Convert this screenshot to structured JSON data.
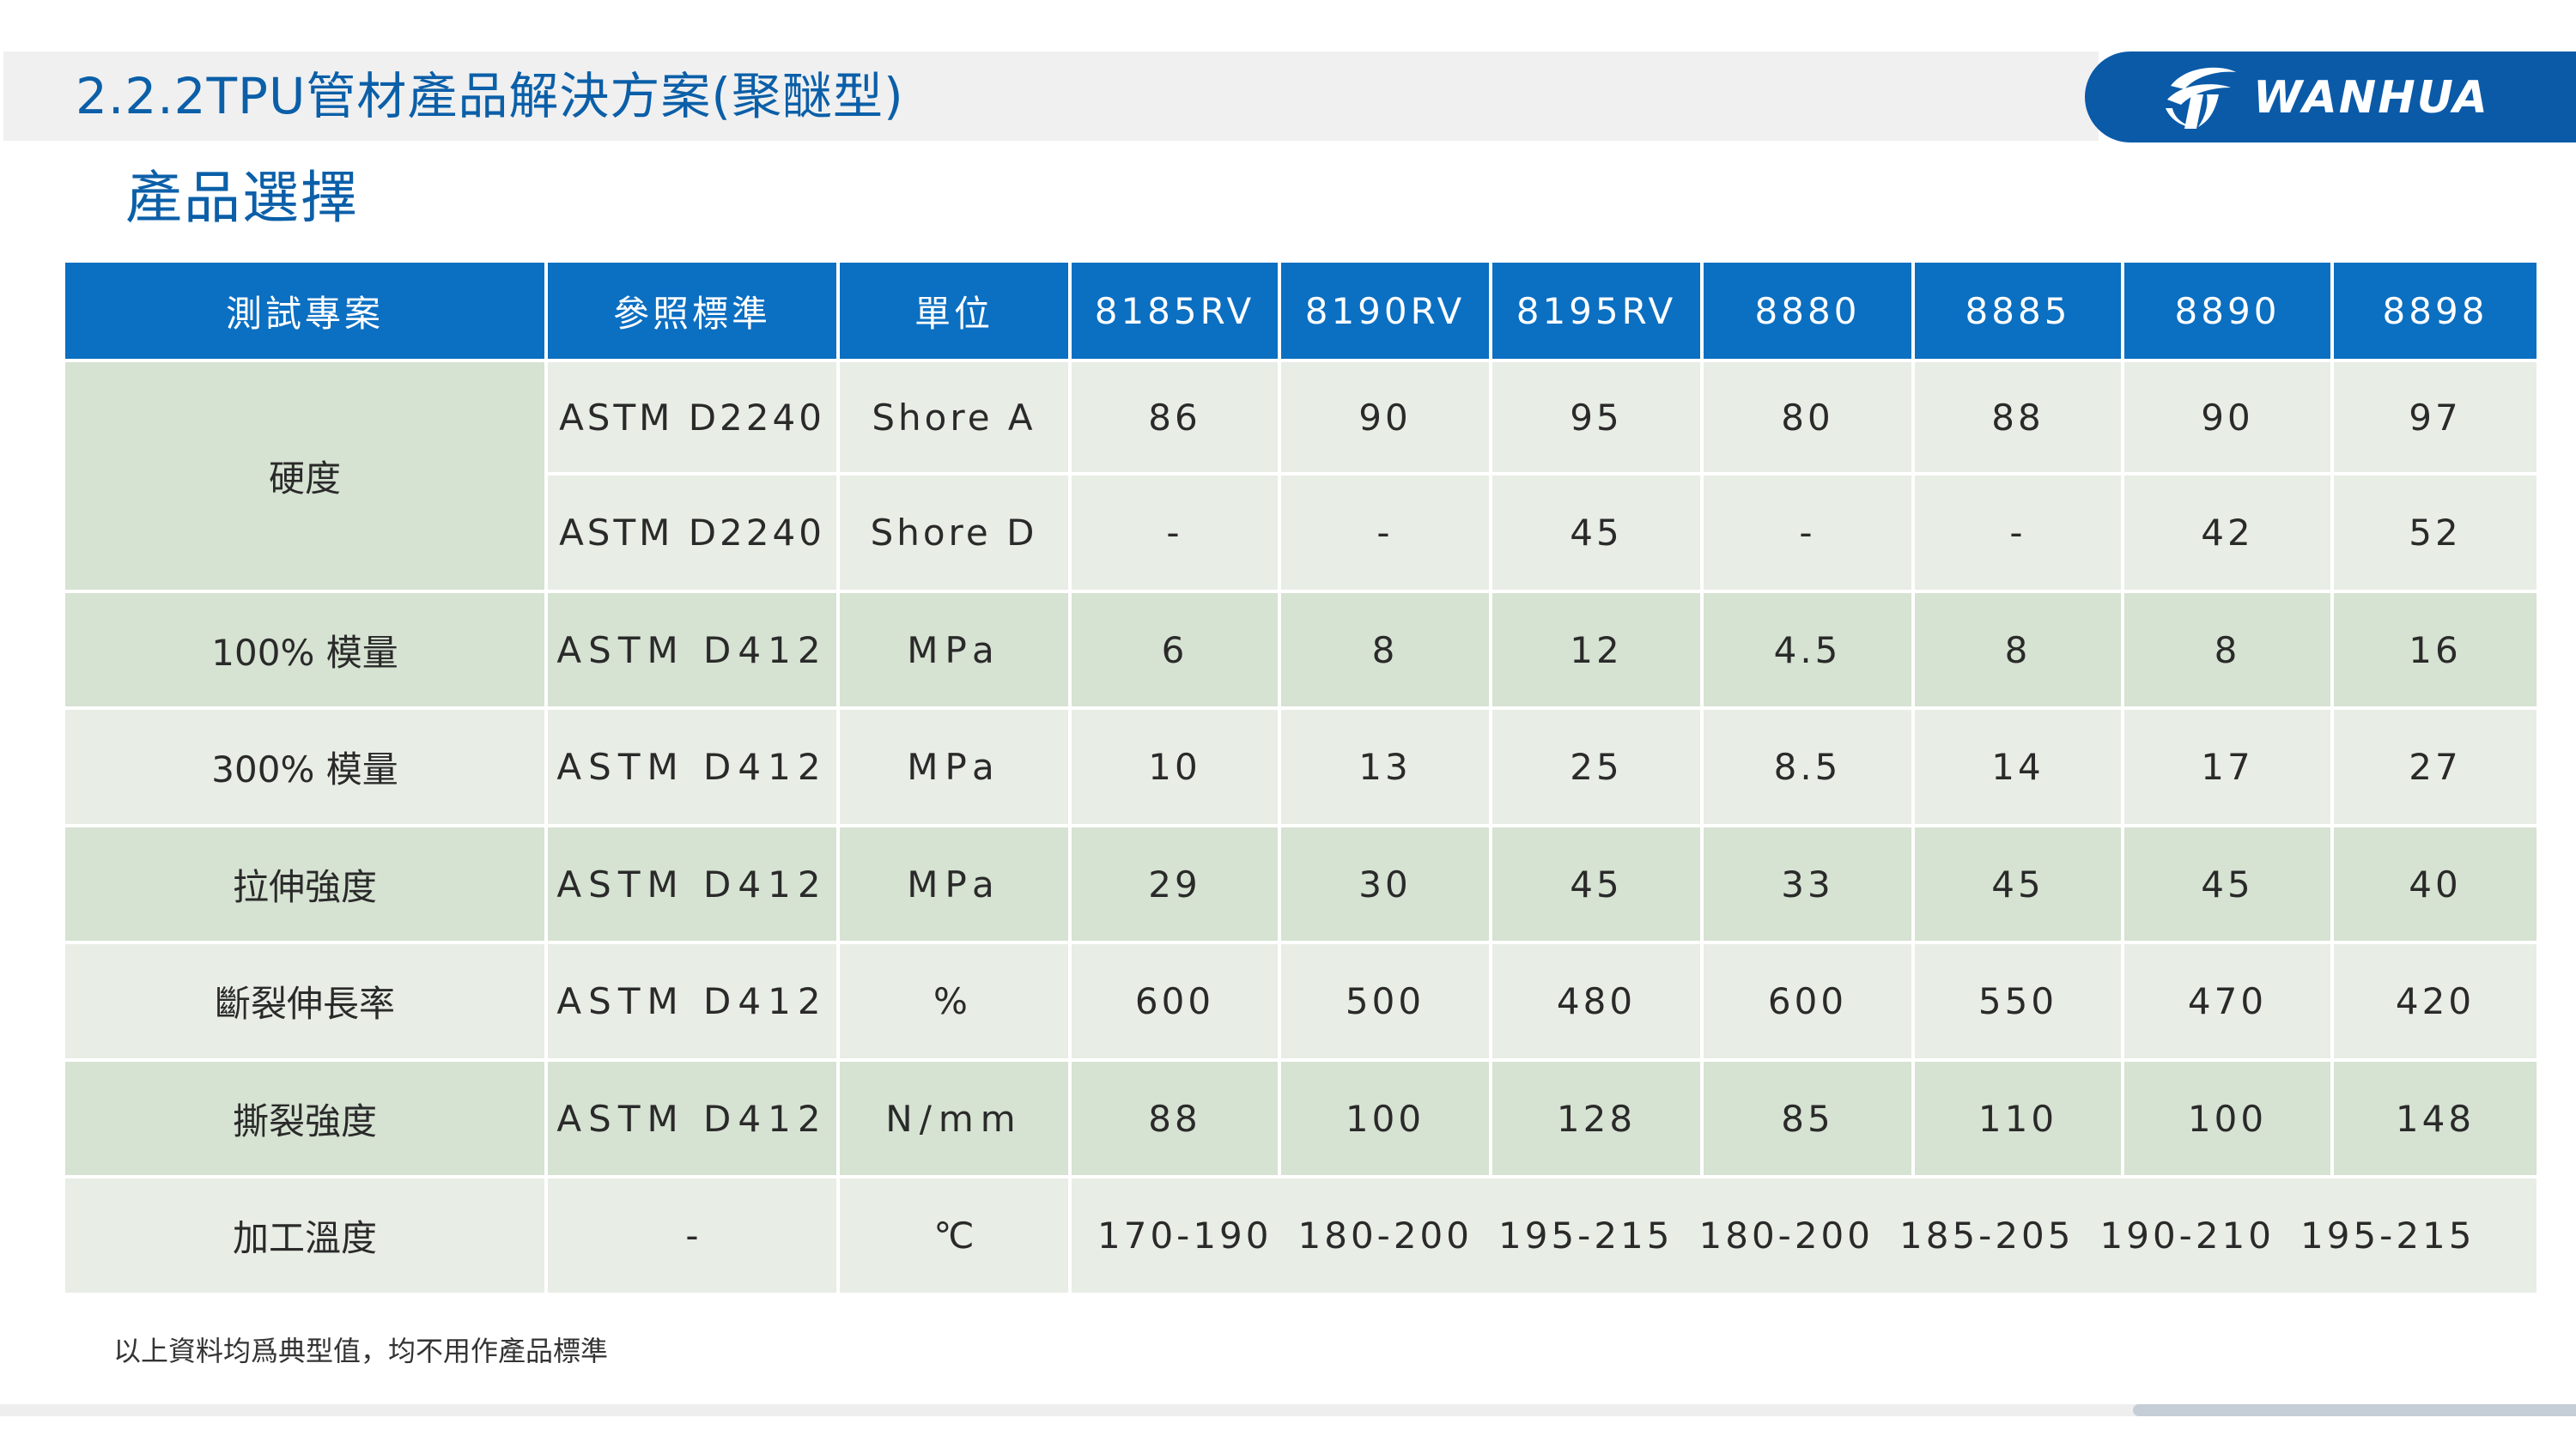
{
  "header": {
    "title": "2.2.2TPU管材產品解決方案(聚醚型)",
    "logo_text": "WANHUA"
  },
  "subtitle": "產品選擇",
  "table": {
    "headers": [
      "測試專案",
      "參照標準",
      "單位",
      "8185RV",
      "8190RV",
      "8195RV",
      "8880",
      "8885",
      "8890",
      "8898"
    ],
    "hardness": {
      "label": "硬度",
      "rows": [
        {
          "standard": "ASTM D2240",
          "unit": "Shore A",
          "values": [
            "86",
            "90",
            "95",
            "80",
            "88",
            "90",
            "97"
          ]
        },
        {
          "standard": "ASTM D2240",
          "unit": "Shore D",
          "values": [
            "-",
            "-",
            "45",
            "-",
            "-",
            "42",
            "52"
          ]
        }
      ]
    },
    "rows": [
      {
        "label": "100% 模量",
        "standard": "ASTM D412",
        "unit": "MPa",
        "values": [
          "6",
          "8",
          "12",
          "4.5",
          "8",
          "8",
          "16"
        ]
      },
      {
        "label": "300% 模量",
        "standard": "ASTM D412",
        "unit": "MPa",
        "values": [
          "10",
          "13",
          "25",
          "8.5",
          "14",
          "17",
          "27"
        ]
      },
      {
        "label": "拉伸強度",
        "standard": "ASTM D412",
        "unit": "MPa",
        "values": [
          "29",
          "30",
          "45",
          "33",
          "45",
          "45",
          "40"
        ]
      },
      {
        "label": "斷裂伸長率",
        "standard": "ASTM D412",
        "unit": "%",
        "values": [
          "600",
          "500",
          "480",
          "600",
          "550",
          "470",
          "420"
        ]
      },
      {
        "label": "撕裂強度",
        "standard": "ASTM D412",
        "unit": "N/mm",
        "values": [
          "88",
          "100",
          "128",
          "85",
          "110",
          "100",
          "148"
        ]
      }
    ],
    "processing": {
      "label": "加工溫度",
      "standard": "-",
      "unit": "℃",
      "values": [
        "170-190",
        "180-200",
        "195-215",
        "180-200",
        "185-205",
        "190-210",
        "195-215"
      ]
    }
  },
  "footnote": "以上資料均爲典型值，均不用作產品標準",
  "colors": {
    "brand_blue": "#0b5fa8",
    "header_blue": "#0b6fc2",
    "row_green": "#d6e2d2",
    "row_light": "#e8ede5"
  }
}
